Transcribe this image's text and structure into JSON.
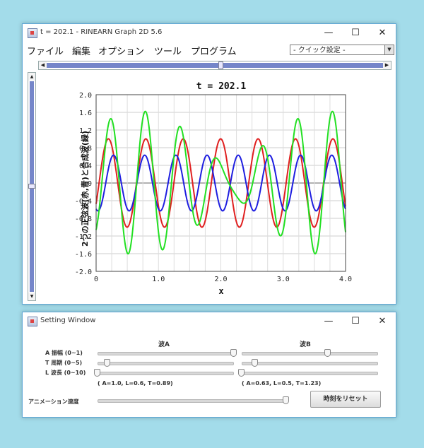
{
  "main_window": {
    "title": "t = 202.1 - RINEARN Graph 2D 5.6",
    "minimize": "—",
    "maximize": "☐",
    "close": "✕",
    "menu": [
      "ファイル",
      "編集",
      "オプション",
      "ツール",
      "プログラム"
    ],
    "quick_setting": "- クイック設定 -",
    "scroll_left": "◀",
    "scroll_right": "▶",
    "scroll_up": "▲",
    "scroll_down": "▼"
  },
  "chart_data": {
    "type": "line",
    "title": "t = 202.1",
    "xlabel": "x",
    "ylabel": "2つの正弦波(赤,青)と合成波(緑)",
    "xlim": [
      0,
      4.0
    ],
    "ylim": [
      -2.0,
      2.0
    ],
    "xticks": [
      "0",
      "1.0",
      "2.0",
      "3.0",
      "4.0"
    ],
    "yticks": [
      "2.0",
      "1.6",
      "1.2",
      "0.8",
      "0.4",
      "0",
      "-0.4",
      "-0.8",
      "-1.2",
      "-1.6",
      "-2.0"
    ],
    "grid": true,
    "series": [
      {
        "color": "#e02020",
        "amplitude": 1.0,
        "wavelength": 0.6,
        "period": 0.89
      },
      {
        "color": "#1f1fe0",
        "amplitude": 0.63,
        "wavelength": 0.5,
        "period": 1.23
      },
      {
        "color": "#22e022",
        "sum_of": [
          0,
          1
        ]
      }
    ]
  },
  "settings_window": {
    "title": "Setting Window",
    "minimize": "—",
    "maximize": "☐",
    "close": "✕",
    "wave_a_header": "波A",
    "wave_b_header": "波B",
    "row_labels": [
      "A 振幅 (0~1)",
      "T 周期 (0~5)",
      "L 波長 (0~10)"
    ],
    "wave_a_params": "( A=1.0, L=0.6, T=0.89)",
    "wave_b_params": "( A=0.63, L=0.5, T=1.23)",
    "animation_label": "アニメーション速度",
    "reset_button": "時刻をリセット",
    "sliders": {
      "a_amp": 1.0,
      "a_period": 0.07,
      "a_wavelength": 0.0,
      "b_amp": 0.63,
      "b_period": 0.1,
      "b_wavelength": 0.0,
      "animation_speed": 0.99
    }
  }
}
